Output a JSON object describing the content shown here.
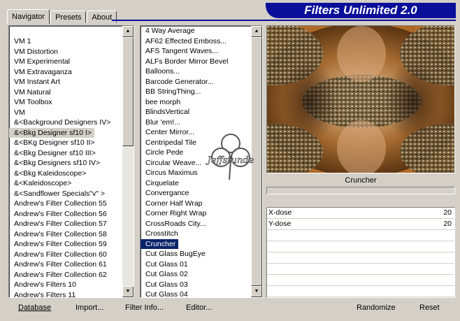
{
  "tabs": [
    "Navigator",
    "Presets",
    "About"
  ],
  "header_title": "Filters Unlimited 2.0",
  "categories": [
    "VM 1",
    "VM Distortion",
    "VM Experimental",
    "VM Extravaganza",
    "VM Instant Art",
    "VM Natural",
    "VM Toolbox",
    "VM",
    "&<Background Designers IV>",
    "&<Bkg Designer sf10 I>",
    "&<BKg Designer sf10 II>",
    "&<Bkg Designer sf10 III>",
    "&<Bkg Designers sf10 IV>",
    "&<Bkg Kaleidoscope>",
    "&<Kaleidoscope>",
    "&<Sandflower Specials\"v\" >",
    "Andrew's Filter Collection 55",
    "Andrew's Filter Collection 56",
    "Andrew's Filter Collection 57",
    "Andrew's Filter Collection 58",
    "Andrew's Filter Collection 59",
    "Andrew's Filter Collection 60",
    "Andrew's Filter Collection 61",
    "Andrew's Filter Collection 62",
    "Andrew's Filters 10",
    "Andrew's Filters 11"
  ],
  "highlighted_category": "&<Bkg Designer sf10 I>",
  "filters": [
    "4 Way Average",
    "AF62 Effected Emboss...",
    "AFS Tangent Waves...",
    "ALFs Border Mirror Bevel",
    "Balloons...",
    "Barcode Generator...",
    "BB StringThing...",
    "bee morph",
    "BlindsVertical",
    "Blur 'em!...",
    "Center Mirror...",
    "Centripedal Tile",
    "Circle Pede",
    "Circular Weave...",
    "Circus Maximus",
    "Cirquelate",
    "Convergance",
    "Corner Half Wrap",
    "Corner Right Wrap",
    "CrossRoads City...",
    "Crosstitch",
    "Cruncher",
    "Cut Glass  BugEye",
    "Cut Glass 01",
    "Cut Glass 02",
    "Cut Glass 03",
    "Cut Glass 04"
  ],
  "selected_filter": "Cruncher",
  "watermark_text": "Jeffstunde",
  "current_filter_label": "Cruncher",
  "params": [
    {
      "label": "X-dose",
      "value": "20"
    },
    {
      "label": "Y-dose",
      "value": "20"
    }
  ],
  "buttons": {
    "database": "Database",
    "import": "Import...",
    "filter_info": "Filter Info...",
    "editor": "Editor...",
    "randomize": "Randomize",
    "reset": "Reset"
  }
}
